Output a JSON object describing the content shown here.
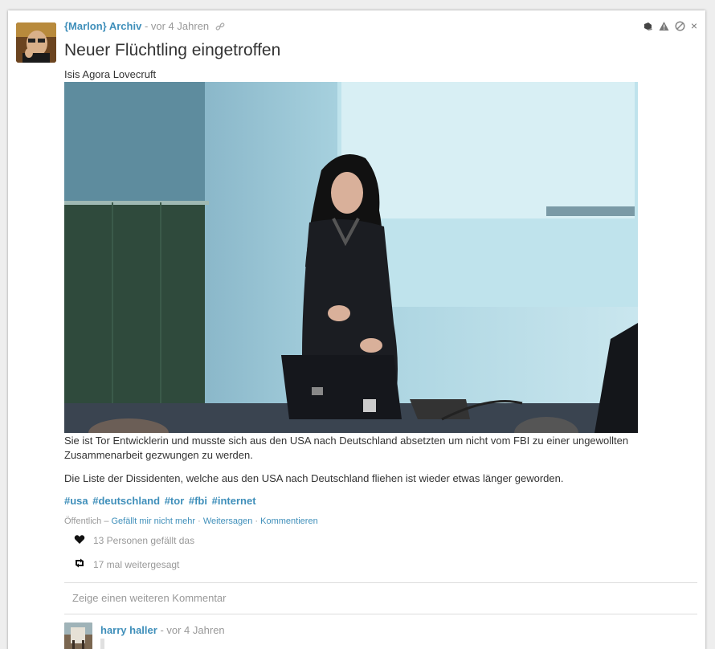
{
  "post": {
    "author": "{Marlon} Archiv",
    "separator": " - ",
    "time": "vor 4 Jahren",
    "title": "Neuer Flüchtling eingetroffen",
    "subtitle": "Isis Agora Lovecruft",
    "paragraph1": "Sie ist Tor Entwicklerin und musste sich aus den USA nach Deutschland absetzten um nicht vom FBI zu einer ungewollten Zusammenarbeit gezwungen zu werden.",
    "paragraph2": "Die Liste der Dissidenten, welche aus den USA nach Deutschland fliehen ist wieder etwas länger geworden.",
    "tags": [
      "#usa",
      "#deutschland",
      "#tor",
      "#fbi",
      "#internet"
    ],
    "visibility": "Öffentlich – ",
    "actions": {
      "dislike": "Gefällt mir nicht mehr",
      "sep": " · ",
      "reshare": "Weitersagen",
      "comment": "Kommentieren"
    },
    "likes": "13 Personen gefällt das",
    "reshares": "17 mal weitergesagt",
    "icons": {
      "link": "link-icon",
      "controls": [
        "shield-icon",
        "warning-icon",
        "block-icon",
        "close-icon"
      ],
      "likes": "heart-icon",
      "reshares": "retweet-icon"
    },
    "close_glyph": "×"
  },
  "comments": {
    "more_label": "Zeige einen weiteren Kommentar",
    "first": {
      "author": "harry haller",
      "separator": " - ",
      "time": "vor 4 Jahren"
    }
  },
  "colors": {
    "link": "#3f8fba",
    "muted": "#999999",
    "text": "#333333"
  }
}
